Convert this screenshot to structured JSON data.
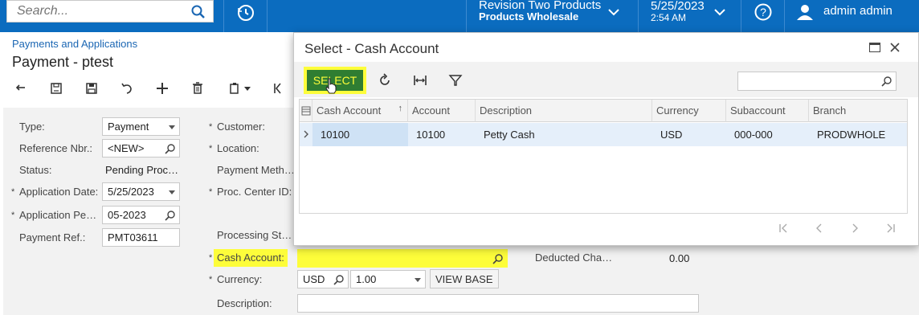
{
  "topbar": {
    "search_placeholder": "Search...",
    "branch_line1": "Revision Two Products",
    "branch_line2": "Products Wholesale",
    "date": "5/25/2023",
    "time": "2:54 AM",
    "user": "admin admin",
    "bg_color": "#0b6cbf"
  },
  "header": {
    "breadcrumb": "Payments and Applications",
    "title": "Payment - ptest"
  },
  "toolbar": {
    "icons": [
      "undo-icon",
      "save-close-icon",
      "save-icon",
      "cancel-icon",
      "add-icon",
      "delete-icon",
      "copy-paste-icon",
      "first-record-icon"
    ]
  },
  "form": {
    "type_label": "Type:",
    "type_value": "Payment",
    "refnbr_label": "Reference Nbr.:",
    "refnbr_value": "<NEW>",
    "status_label": "Status:",
    "status_value": "Pending Proc…",
    "appdate_label": "Application Date:",
    "appdate_value": "5/25/2023",
    "appperiod_label": "Application Pe…",
    "appperiod_value": "05-2023",
    "payref_label": "Payment Ref.:",
    "payref_value": "PMT03611",
    "customer_label": "Customer:",
    "location_label": "Location:",
    "paymethod_label": "Payment Meth…",
    "proccenter_label": "Proc. Center ID:",
    "procstatus_label": "Processing St…",
    "cashaccount_label": "Cash Account:",
    "cashaccount_value": "",
    "currency_label": "Currency:",
    "currency_value": "USD",
    "rate_value": "1.00",
    "viewbase_label": "VIEW BASE",
    "description_label": "Description:",
    "description_value": "",
    "deducted_label": "Deducted Cha…",
    "deducted_value": "0.00"
  },
  "dialog": {
    "title": "Select - Cash Account",
    "select_label": "SELECT",
    "search_value": "",
    "columns": [
      "Cash Account",
      "Account",
      "Description",
      "Currency",
      "Subaccount",
      "Branch"
    ],
    "rows": [
      {
        "cash_account": "10100",
        "account": "10100",
        "description": "Petty Cash",
        "currency": "USD",
        "subaccount": "000-000",
        "branch": "PRODWHOLE"
      }
    ],
    "highlight_color": "#fdfd3a",
    "select_bg": "#2f7d32"
  }
}
